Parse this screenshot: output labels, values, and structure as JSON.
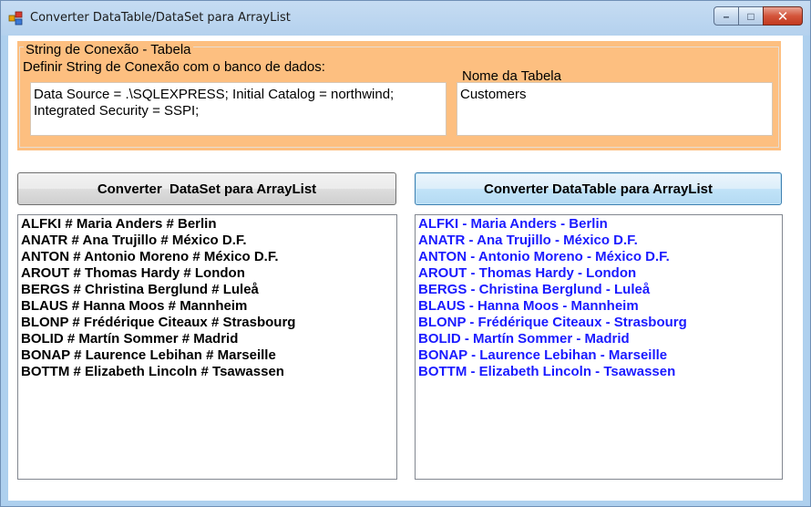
{
  "window": {
    "title": "Converter DataTable/DataSet para ArrayList",
    "minimize_glyph": "–",
    "maximize_glyph": "□",
    "close_glyph": "✕"
  },
  "group": {
    "title": "String de Conexão - Tabela",
    "connection_label": "Definir String de Conexão com o banco de dados:",
    "connection_value": "Data Source = .\\SQLEXPRESS; Initial Catalog = northwind;\nIntegrated Security = SSPI;",
    "table_label": "Nome da Tabela",
    "table_value": "Customers"
  },
  "buttons": {
    "dataset_label": "Converter  DataSet para ArrayList",
    "datatable_label": "Converter DataTable para ArrayList"
  },
  "dataset_list": [
    "ALFKI # Maria Anders # Berlin",
    "ANATR # Ana Trujillo # México D.F.",
    "ANTON # Antonio Moreno # México D.F.",
    "AROUT # Thomas Hardy # London",
    "BERGS # Christina Berglund # Luleå",
    "BLAUS # Hanna Moos # Mannheim",
    "BLONP # Frédérique Citeaux # Strasbourg",
    "BOLID # Martín Sommer # Madrid",
    "BONAP # Laurence Lebihan # Marseille",
    "BOTTM # Elizabeth Lincoln # Tsawassen"
  ],
  "datatable_list": [
    "ALFKI - Maria Anders - Berlin",
    "ANATR - Ana Trujillo - México D.F.",
    "ANTON - Antonio Moreno - México D.F.",
    "AROUT - Thomas Hardy - London",
    "BERGS - Christina Berglund - Luleå",
    "BLAUS - Hanna Moos - Mannheim",
    "BLONP - Frédérique Citeaux - Strasbourg",
    "BOLID - Martín Sommer - Madrid",
    "BONAP - Laurence Lebihan - Marseille",
    "BOTTM - Elizabeth Lincoln - Tsawassen"
  ],
  "icons": {
    "app": "app-icon",
    "minimize": "minimize-icon",
    "maximize": "maximize-icon",
    "close": "close-icon"
  },
  "colors": {
    "groupbox_background": "#fdbf80",
    "dataset_text": "#000000",
    "datatable_text": "#1a1aff",
    "titlebar": "#b4d1ee"
  }
}
